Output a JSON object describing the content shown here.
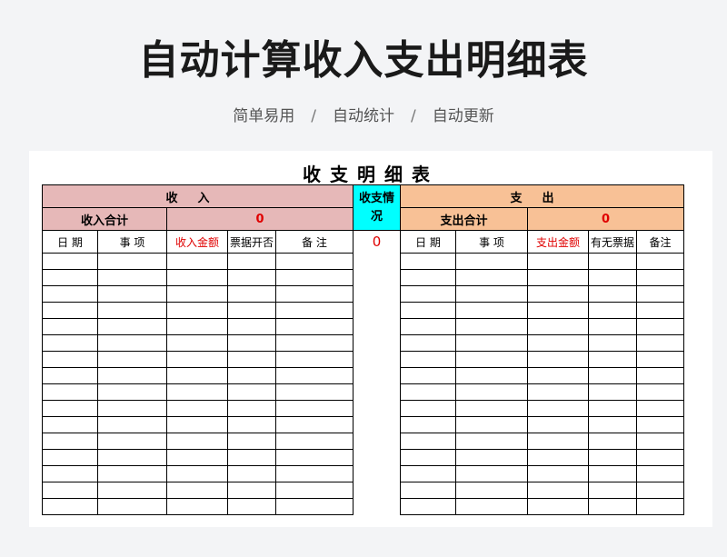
{
  "page": {
    "title": "自动计算收入支出明细表",
    "features": [
      "简单易用",
      "自动统计",
      "自动更新"
    ],
    "separator": "/"
  },
  "sheet": {
    "title": "收支明细表",
    "income": {
      "header": "收入",
      "total_label": "收入合计",
      "total_value": "0",
      "columns": [
        "日 期",
        "事 项",
        "收入金额",
        "票据开否",
        "备 注"
      ]
    },
    "balance": {
      "header": "收支情况",
      "value": "0"
    },
    "expense": {
      "header": "支出",
      "total_label": "支出合计",
      "total_value": "0",
      "columns": [
        "日 期",
        "事 项",
        "支出金额",
        "有无票据",
        "备注"
      ]
    },
    "empty_rows": 16
  },
  "colors": {
    "income_fill": "#e6b8b8",
    "expense_fill": "#f8c196",
    "balance_fill": "#00ffff",
    "amount_red": "#e00000"
  }
}
